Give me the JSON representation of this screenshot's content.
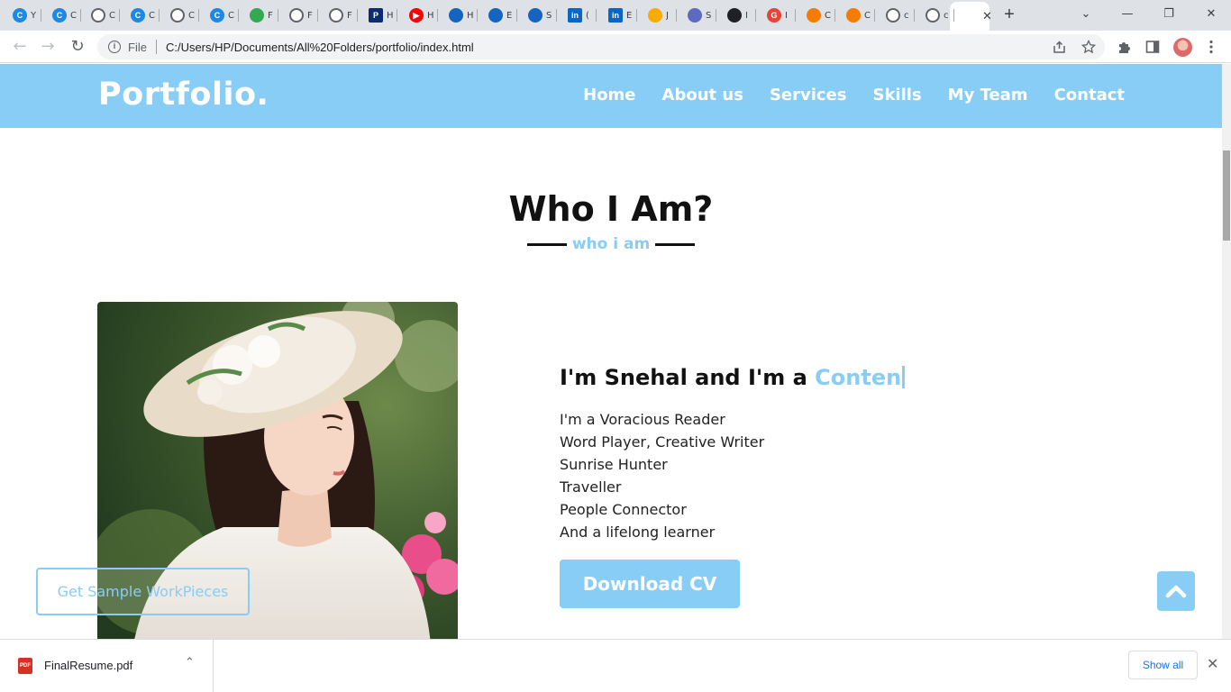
{
  "browser": {
    "tabs": [
      {
        "icon": "canva-icon",
        "color": "#1e88e5",
        "glyph": "C",
        "label": "Y"
      },
      {
        "icon": "canva-icon",
        "color": "#1e88e5",
        "glyph": "C",
        "label": "C"
      },
      {
        "icon": "globe-icon",
        "color": "#5f6368",
        "glyph": "",
        "label": "C"
      },
      {
        "icon": "canva-icon",
        "color": "#1e88e5",
        "glyph": "C",
        "label": "C"
      },
      {
        "icon": "globe-icon",
        "color": "#5f6368",
        "glyph": "",
        "label": "C"
      },
      {
        "icon": "canva-icon",
        "color": "#1e88e5",
        "glyph": "C",
        "label": "C"
      },
      {
        "icon": "google-drive-icon",
        "color": "#34a853",
        "glyph": "",
        "label": "F"
      },
      {
        "icon": "globe-icon",
        "color": "#5f6368",
        "glyph": "",
        "label": "F"
      },
      {
        "icon": "globe-icon",
        "color": "#5f6368",
        "glyph": "",
        "label": "F"
      },
      {
        "icon": "p-logo-icon",
        "color": "#0d2c6e",
        "glyph": "P",
        "label": "H"
      },
      {
        "icon": "youtube-icon",
        "color": "#ff0000",
        "glyph": "▶",
        "label": "H"
      },
      {
        "icon": "bird-icon",
        "color": "#1565c0",
        "glyph": "",
        "label": "H"
      },
      {
        "icon": "bird-icon",
        "color": "#1565c0",
        "glyph": "",
        "label": "E"
      },
      {
        "icon": "bird-icon",
        "color": "#1565c0",
        "glyph": "",
        "label": "S"
      },
      {
        "icon": "linkedin-icon",
        "color": "#0a66c2",
        "glyph": "in",
        "label": "("
      },
      {
        "icon": "linkedin-icon",
        "color": "#0a66c2",
        "glyph": "in",
        "label": "E"
      },
      {
        "icon": "bars-icon",
        "color": "#f9ab00",
        "glyph": "",
        "label": "J"
      },
      {
        "icon": "spiral-icon",
        "color": "#5c6bc0",
        "glyph": "",
        "label": "S"
      },
      {
        "icon": "github-icon",
        "color": "#202124",
        "glyph": "",
        "label": "I"
      },
      {
        "icon": "google-icon",
        "color": "#ea4335",
        "glyph": "G",
        "label": "I"
      },
      {
        "icon": "orange-tab-icon",
        "color": "#f57c00",
        "glyph": "",
        "label": "C"
      },
      {
        "icon": "orange-tab-icon",
        "color": "#f57c00",
        "glyph": "",
        "label": "C"
      },
      {
        "icon": "globe-icon",
        "color": "#5f6368",
        "glyph": "",
        "label": "c"
      },
      {
        "icon": "globe-icon",
        "color": "#5f6368",
        "glyph": "",
        "label": "c"
      }
    ],
    "active_tab": {
      "label": "P",
      "close": "✕"
    },
    "new_tab": "+",
    "window_controls": {
      "dropdown": "⌄",
      "minimize": "—",
      "restore": "❐",
      "close": "✕"
    },
    "back": "←",
    "forward": "→",
    "reload": "↻",
    "scheme": "File",
    "url": "C:/Users/HP/Documents/All%20Folders/portfolio/index.html",
    "info_glyph": "i"
  },
  "site": {
    "logo": "Portfolio.",
    "nav": [
      "Home",
      "About us",
      "Services",
      "Skills",
      "My Team",
      "Contact"
    ],
    "section_title": "Who I Am?",
    "section_subtitle": "who i am",
    "intro_prefix": "I'm Snehal and I'm a ",
    "intro_role": "Conten",
    "about_lines": [
      "I'm a Voracious Reader",
      "Word Player, Creative Writer",
      "Sunrise Hunter",
      "Traveller",
      "People Connector",
      "And a lifelong learner"
    ],
    "download_cv": "Download CV",
    "sample_button": "Get Sample WorkPieces",
    "accent_color": "#88cdf6"
  },
  "downloads": {
    "file_name": "FinalResume.pdf",
    "file_badge": "PDF",
    "caret": "⌃",
    "show_all": "Show all",
    "close": "✕"
  }
}
